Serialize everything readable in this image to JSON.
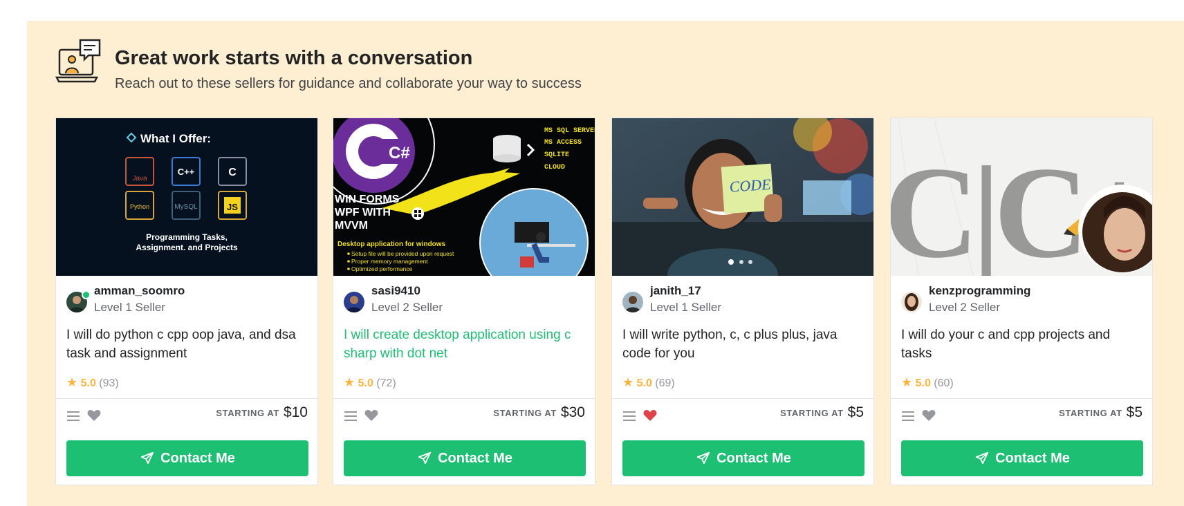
{
  "section": {
    "title": "Great work starts with a conversation",
    "subtitle": "Reach out to these sellers for guidance and collaborate your way to success",
    "icon": "chat-laptop-icon"
  },
  "colors": {
    "panel_bg": "#ffefd2",
    "brand_green": "#1dbf73",
    "star": "#ffb33e",
    "heart_active": "#e0424b"
  },
  "cards": [
    {
      "thumb": {
        "heading": "What I Offer:",
        "icons": [
          "Java",
          "C++",
          "C",
          "Python",
          "MySQL",
          "JS"
        ],
        "caption_line1": "Programming Tasks,",
        "caption_line2": "Assignment. and Projects"
      },
      "seller_name": "amman_soomro",
      "seller_level": "Level 1 Seller",
      "title": "I will do python c cpp oop java, and dsa task and assignment",
      "rating": "5.0",
      "reviews": "(93)",
      "starting_label": "STARTING AT",
      "price": "$10",
      "favorited": false,
      "contact_label": "Contact Me"
    },
    {
      "thumb": {
        "logo": "C#",
        "db_labels": [
          "MS SQL SERVER",
          "MS ACCESS",
          "SQLITE",
          "CLOUD"
        ],
        "banner_line1": "WIN FORMS",
        "banner_line2": "WPF WITH",
        "banner_line3": "MVVM",
        "footer_title": "Desktop application for windows",
        "bullets": [
          "Setup file will be provided upon request",
          "Proper memory management",
          "Optimized performance"
        ]
      },
      "seller_name": "sasi9410",
      "seller_level": "Level 2 Seller",
      "title": "I will create desktop application using c sharp with dot net",
      "rating": "5.0",
      "reviews": "(72)",
      "starting_label": "STARTING AT",
      "price": "$30",
      "favorited": false,
      "contact_label": "Contact Me"
    },
    {
      "thumb": {
        "note_text": "CODE"
      },
      "seller_name": "janith_17",
      "seller_level": "Level 1 Seller",
      "title": "I will write python, c, c plus plus, java code for you",
      "rating": "5.0",
      "reviews": "(69)",
      "starting_label": "STARTING AT",
      "price": "$5",
      "favorited": true,
      "contact_label": "Contact Me"
    },
    {
      "thumb": {
        "art_text": "C|C++"
      },
      "seller_name": "kenzprogramming",
      "seller_level": "Level 2 Seller",
      "title": "I will do your c and cpp projects and tasks",
      "rating": "5.0",
      "reviews": "(60)",
      "starting_label": "STARTING AT",
      "price": "$5",
      "favorited": false,
      "contact_label": "Contact Me"
    }
  ]
}
